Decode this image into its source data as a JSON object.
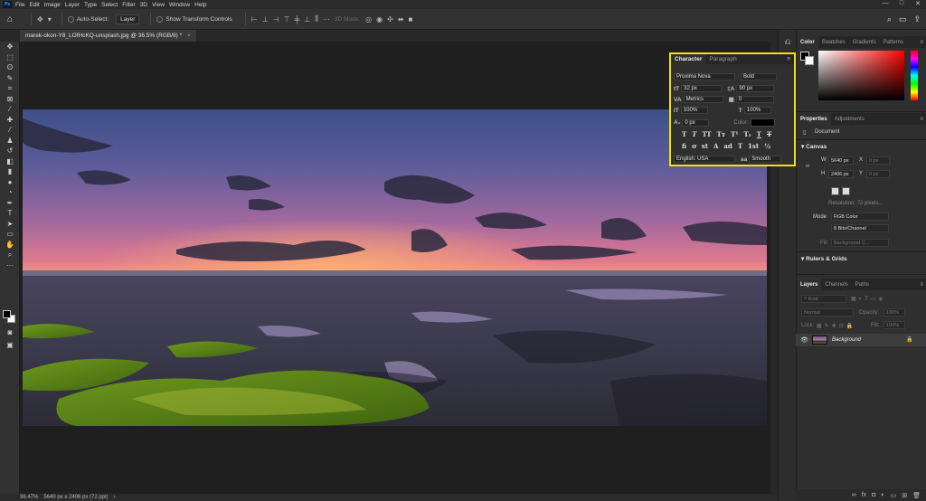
{
  "menubar": {
    "app_icon": "Ps",
    "items": [
      "File",
      "Edit",
      "Image",
      "Layer",
      "Type",
      "Select",
      "Filter",
      "3D",
      "View",
      "Window",
      "Help"
    ],
    "window_controls": [
      "—",
      "□",
      "✕"
    ]
  },
  "options_bar": {
    "auto_select_label": "Auto-Select:",
    "auto_select_value": "Layer",
    "show_transform_label": "Show Transform Controls",
    "mode_3d_label": "3D Mode:"
  },
  "document_tab": {
    "title": "marek-okon-Y8_LOfHcKQ-unsplash.jpg @ 36.5% (RGB/8) *",
    "close": "×"
  },
  "status_bar": {
    "zoom": "36.47%",
    "doc_info": "5640 px x 2406 px (72 ppi)",
    "arrow": "›"
  },
  "character_panel": {
    "tabs": [
      "Character",
      "Paragraph"
    ],
    "font_family": "Proxima Nova",
    "font_style": "Bold",
    "font_size": "32 px",
    "leading": "90 px",
    "kerning": "Metrics",
    "tracking": "0",
    "vertical_scale": "100%",
    "horizontal_scale": "100%",
    "baseline_shift": "0 px",
    "color_label": "Color:",
    "color_value": "#000000",
    "style_glyphs_row1": [
      "T",
      "T",
      "TT",
      "Tт",
      "T¹",
      "T₁",
      "T",
      "T"
    ],
    "style_glyphs_row2": [
      "fi",
      "ơ",
      "st",
      "A",
      "ad",
      "T",
      "1st",
      "½"
    ],
    "language": "English: USA",
    "aa_label": "aa",
    "antialias": "Smooth"
  },
  "color_panel": {
    "tabs": [
      "Color",
      "Swatches",
      "Gradients",
      "Patterns"
    ]
  },
  "properties_panel": {
    "tabs": [
      "Properties",
      "Adjustments"
    ],
    "doc_label": "Document",
    "canvas_label": "Canvas",
    "w_label": "W",
    "w_value": "5640 px",
    "h_label": "H",
    "h_value": "2406 px",
    "x_label": "X",
    "x_value": "0 px",
    "y_label": "Y",
    "y_value": "0 px",
    "resolution": "Resolution: 72 pixels...",
    "mode_label": "Mode",
    "mode_value": "RGB Color",
    "bits_value": "8 Bits/Channel",
    "fill_label": "Fill",
    "fill_value": "Background C...",
    "rulers_label": "Rulers & Grids"
  },
  "layers_panel": {
    "tabs": [
      "Layers",
      "Channels",
      "Paths"
    ],
    "kind_label": "Kind",
    "blend_mode": "Normal",
    "opacity_label": "Opacity:",
    "opacity_value": "100%",
    "lock_label": "Lock:",
    "fill_label": "Fill:",
    "fill_value": "100%",
    "layer_name": "Background",
    "footer_icons": [
      "∞",
      "fx",
      "◘",
      "◐",
      "▭",
      "⊞",
      "🗑"
    ]
  },
  "colors": {
    "highlight": "#f3e400",
    "panel_bg": "#2f2f2f",
    "canvas_bg": "#1f1f1f"
  }
}
